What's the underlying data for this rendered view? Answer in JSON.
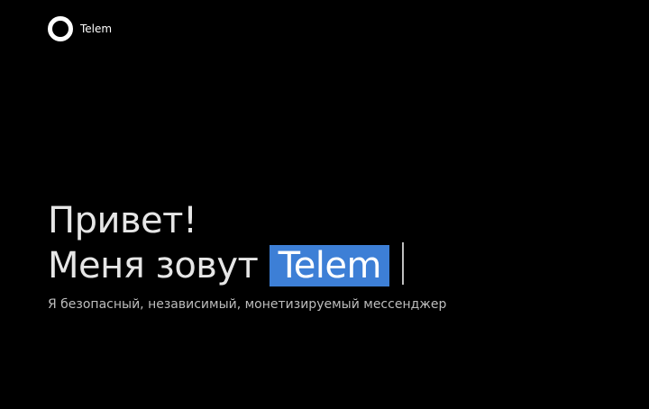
{
  "header": {
    "logo_icon": "ring-logo-icon",
    "brand_name": "Telem"
  },
  "hero": {
    "greeting": "Привет!",
    "name_prefix": "Меня зовут",
    "name_highlight": "Telem",
    "highlight_color": "#3d7fd6"
  },
  "tagline": "Я безопасный, независимый, монетизируемый мессенджер"
}
